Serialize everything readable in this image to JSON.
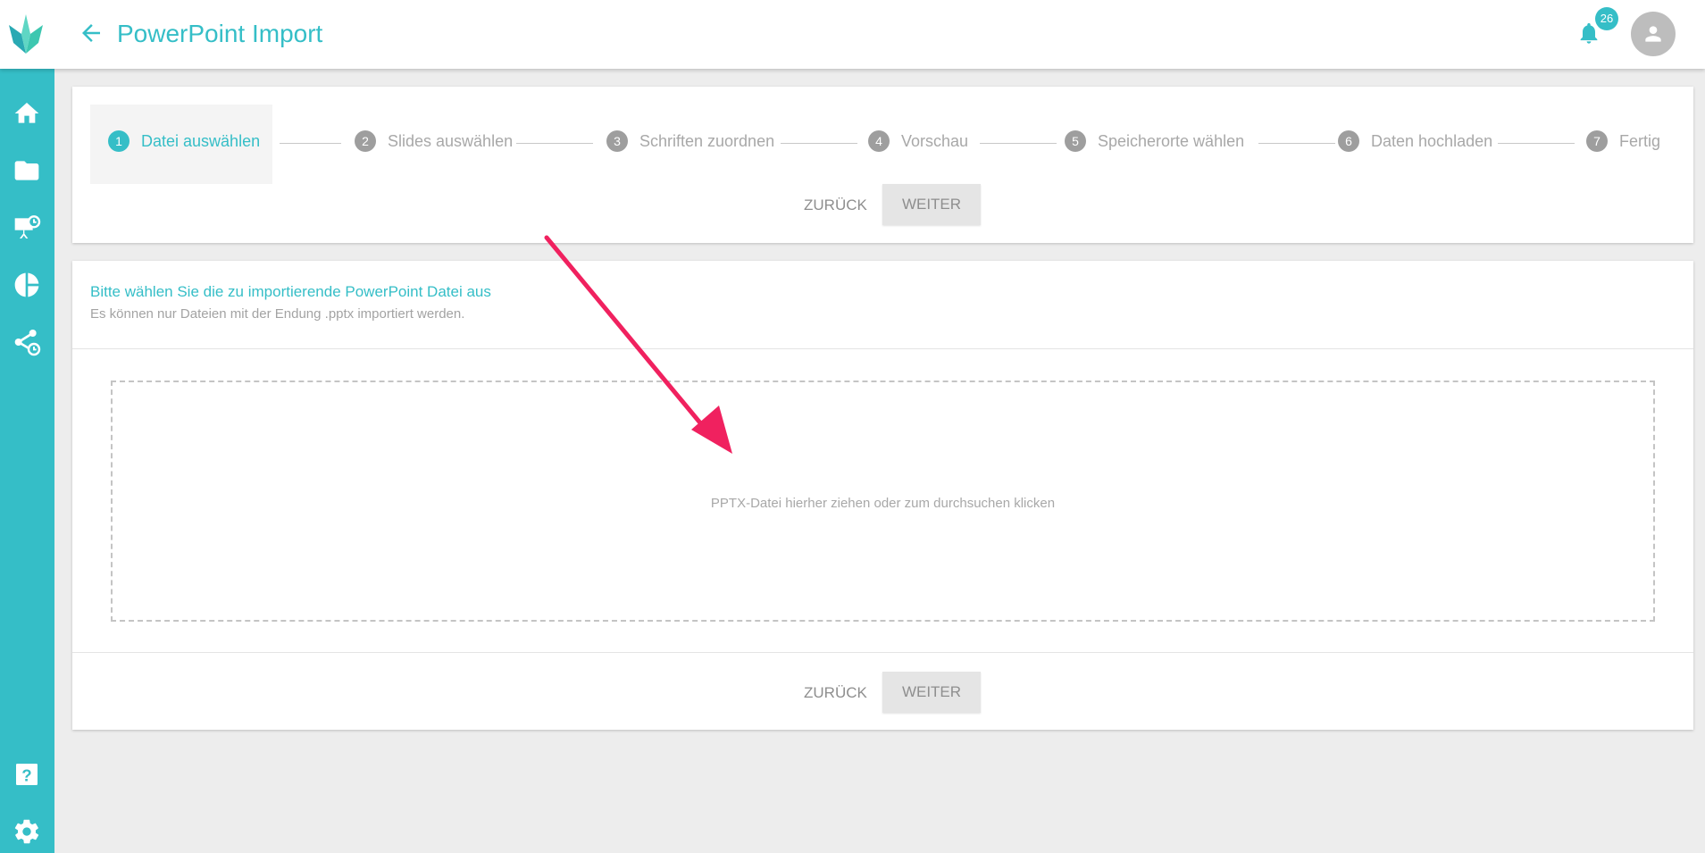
{
  "header": {
    "title": "PowerPoint Import",
    "notification_count": "26"
  },
  "sidebar": {
    "items": [
      {
        "name": "home-icon"
      },
      {
        "name": "folder-icon"
      },
      {
        "name": "presentation-icon"
      },
      {
        "name": "pie-chart-icon"
      },
      {
        "name": "share-icon"
      }
    ],
    "bottom_items": [
      {
        "name": "help-icon"
      },
      {
        "name": "settings-icon"
      }
    ]
  },
  "stepper": {
    "steps": [
      {
        "num": "1",
        "label": "Datei auswählen",
        "active": true
      },
      {
        "num": "2",
        "label": "Slides auswählen",
        "active": false
      },
      {
        "num": "3",
        "label": "Schriften zuordnen",
        "active": false
      },
      {
        "num": "4",
        "label": "Vorschau",
        "active": false
      },
      {
        "num": "5",
        "label": "Speicherorte wählen",
        "active": false
      },
      {
        "num": "6",
        "label": "Daten hochladen",
        "active": false
      },
      {
        "num": "7",
        "label": "Fertig",
        "active": false
      }
    ],
    "back_label": "Zurück",
    "next_label": "Weiter"
  },
  "main": {
    "title": "Bitte wählen Sie die zu importierende PowerPoint Datei aus",
    "subtitle": "Es können nur Dateien mit der Endung .pptx importiert werden.",
    "dropzone_text": "PPTX-Datei hierher ziehen oder zum durchsuchen klicken",
    "back_label": "Zurück",
    "next_label": "Weiter"
  },
  "colors": {
    "accent": "#35bec7",
    "annotation_arrow": "#f0215f",
    "inactive_step": "#9e9e9e"
  }
}
